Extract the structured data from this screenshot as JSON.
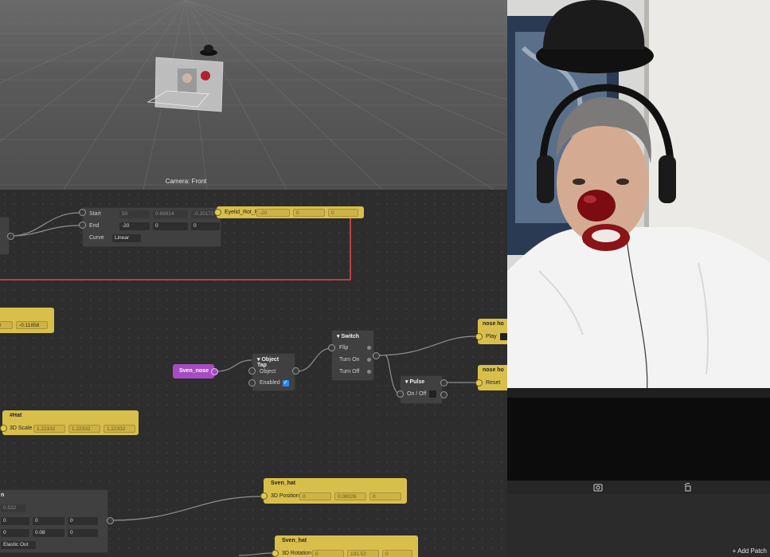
{
  "viewport": {
    "camera_label": "Camera: Front"
  },
  "nodes": {
    "animation": {
      "start_label": "Start",
      "start_values": [
        "50",
        "0.69814",
        "-0.20171"
      ],
      "end_label": "End",
      "end_values": [
        "-20",
        "0",
        "0"
      ],
      "curve_label": "Curve",
      "curve_value": "Linear"
    },
    "eyelid": {
      "label": "Eyelid_Rot_R",
      "values": [
        "-20",
        "0",
        "0"
      ]
    },
    "left_partial": {
      "values": [
        "8",
        "-0.11858"
      ]
    },
    "nose_obj": {
      "label": "Sven_nose"
    },
    "object_tap": {
      "title": "Object Tap",
      "object_label": "Object",
      "enabled_label": "Enabled",
      "check": "✓"
    },
    "switch": {
      "title": "Switch",
      "flip": "Flip",
      "turn_on": "Turn On",
      "turn_off": "Turn Off"
    },
    "pulse": {
      "title": "Pulse",
      "on_off": "On / Off"
    },
    "nose_play": {
      "title": "nose ho",
      "port": "Play"
    },
    "nose_reset": {
      "title": "nose ho",
      "port": "Reset"
    },
    "hat_scale": {
      "title": "#Hat",
      "port": "3D Scale",
      "values": [
        "1.22332",
        "1.22332",
        "1.22332"
      ]
    },
    "bottom_left": {
      "title": "n",
      "first": "0.532",
      "row1": [
        "0",
        "0",
        "0"
      ],
      "row2": [
        "0",
        "0.08",
        "0"
      ],
      "easing": "Elastic Out"
    },
    "hat_pos": {
      "title": "Sven_hat",
      "port": "3D Position",
      "values": [
        "0",
        "0.08026",
        "0"
      ]
    },
    "hat_rot": {
      "title": "Sven_hat",
      "port": "3D Rotation",
      "values": [
        "0",
        "191.52",
        "0"
      ]
    }
  },
  "toolbar": {
    "add_patch": "Add Patch",
    "add_icon": "+"
  },
  "preview_bar": {
    "capture_icon": "capture-icon",
    "rotate_icon": "rotate-icon"
  },
  "colors": {
    "node_yellow": "#d8bf4c",
    "node_purple": "#a64bc3",
    "wire_red": "#e04848",
    "accent_blue": "#2b8cf0"
  }
}
